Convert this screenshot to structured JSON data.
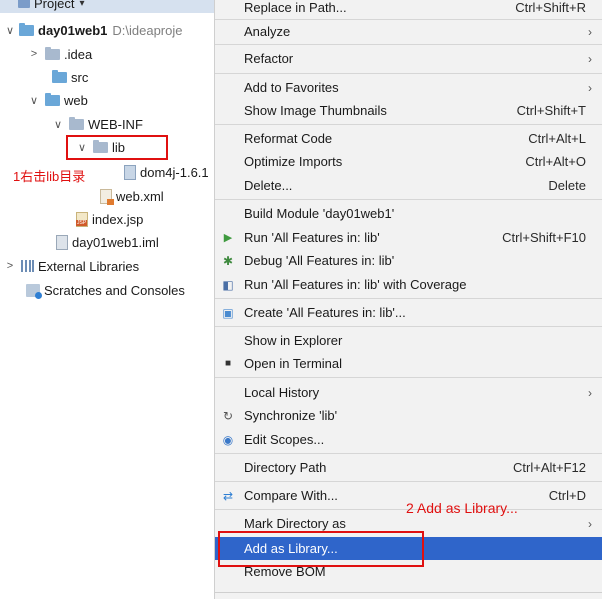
{
  "tree": {
    "header_label": "Project",
    "project_name": "day01web1",
    "project_path": "D:\\ideaproje",
    "items": {
      "idea": ".idea",
      "src": "src",
      "web": "web",
      "webinf": "WEB-INF",
      "lib": "lib",
      "dom4j": "dom4j-1.6.1",
      "webxml": "web.xml",
      "indexjsp": "index.jsp",
      "iml": "day01web1.iml",
      "extlibs": "External Libraries",
      "scratches": "Scratches and Consoles"
    },
    "annotation": "1右击lib目录"
  },
  "menu": {
    "items": [
      {
        "label": "Replace in Path...",
        "shortcut": "Ctrl+Shift+R"
      },
      {
        "label": "Analyze",
        "submenu": true
      },
      {
        "label": "Refactor",
        "submenu": true
      },
      {
        "label": "Add to Favorites",
        "submenu": true
      },
      {
        "label": "Show Image Thumbnails",
        "shortcut": "Ctrl+Shift+T"
      },
      {
        "label": "Reformat Code",
        "shortcut": "Ctrl+Alt+L"
      },
      {
        "label": "Optimize Imports",
        "shortcut": "Ctrl+Alt+O"
      },
      {
        "label": "Delete...",
        "shortcut": "Delete"
      },
      {
        "label": "Build Module 'day01web1'"
      },
      {
        "label": "Run 'All Features in: lib'",
        "shortcut": "Ctrl+Shift+F10",
        "icon": "run-icon"
      },
      {
        "label": "Debug 'All Features in: lib'",
        "icon": "debug-icon"
      },
      {
        "label": "Run 'All Features in: lib' with Coverage",
        "icon": "coverage-icon"
      },
      {
        "label": "Create 'All Features in: lib'...",
        "icon": "create-config-icon"
      },
      {
        "label": "Show in Explorer"
      },
      {
        "label": "Open in Terminal",
        "icon": "terminal-icon"
      },
      {
        "label": "Local History",
        "submenu": true
      },
      {
        "label": "Synchronize 'lib'",
        "icon": "sync-icon"
      },
      {
        "label": "Edit Scopes...",
        "icon": "scope-icon"
      },
      {
        "label": "Directory Path",
        "shortcut": "Ctrl+Alt+F12"
      },
      {
        "label": "Compare With...",
        "shortcut": "Ctrl+D",
        "icon": "compare-icon"
      },
      {
        "label": "Mark Directory as",
        "submenu": true
      },
      {
        "label": "Add as Library...",
        "selected": true
      },
      {
        "label": "Remove BOM"
      }
    ],
    "annotation": "2 Add as Library..."
  },
  "colors": {
    "selection": "#2f65ca",
    "annotation_red": "#e01010",
    "menu_bg": "#f2f2f2",
    "tree_header_bg": "#d6e1ef"
  }
}
